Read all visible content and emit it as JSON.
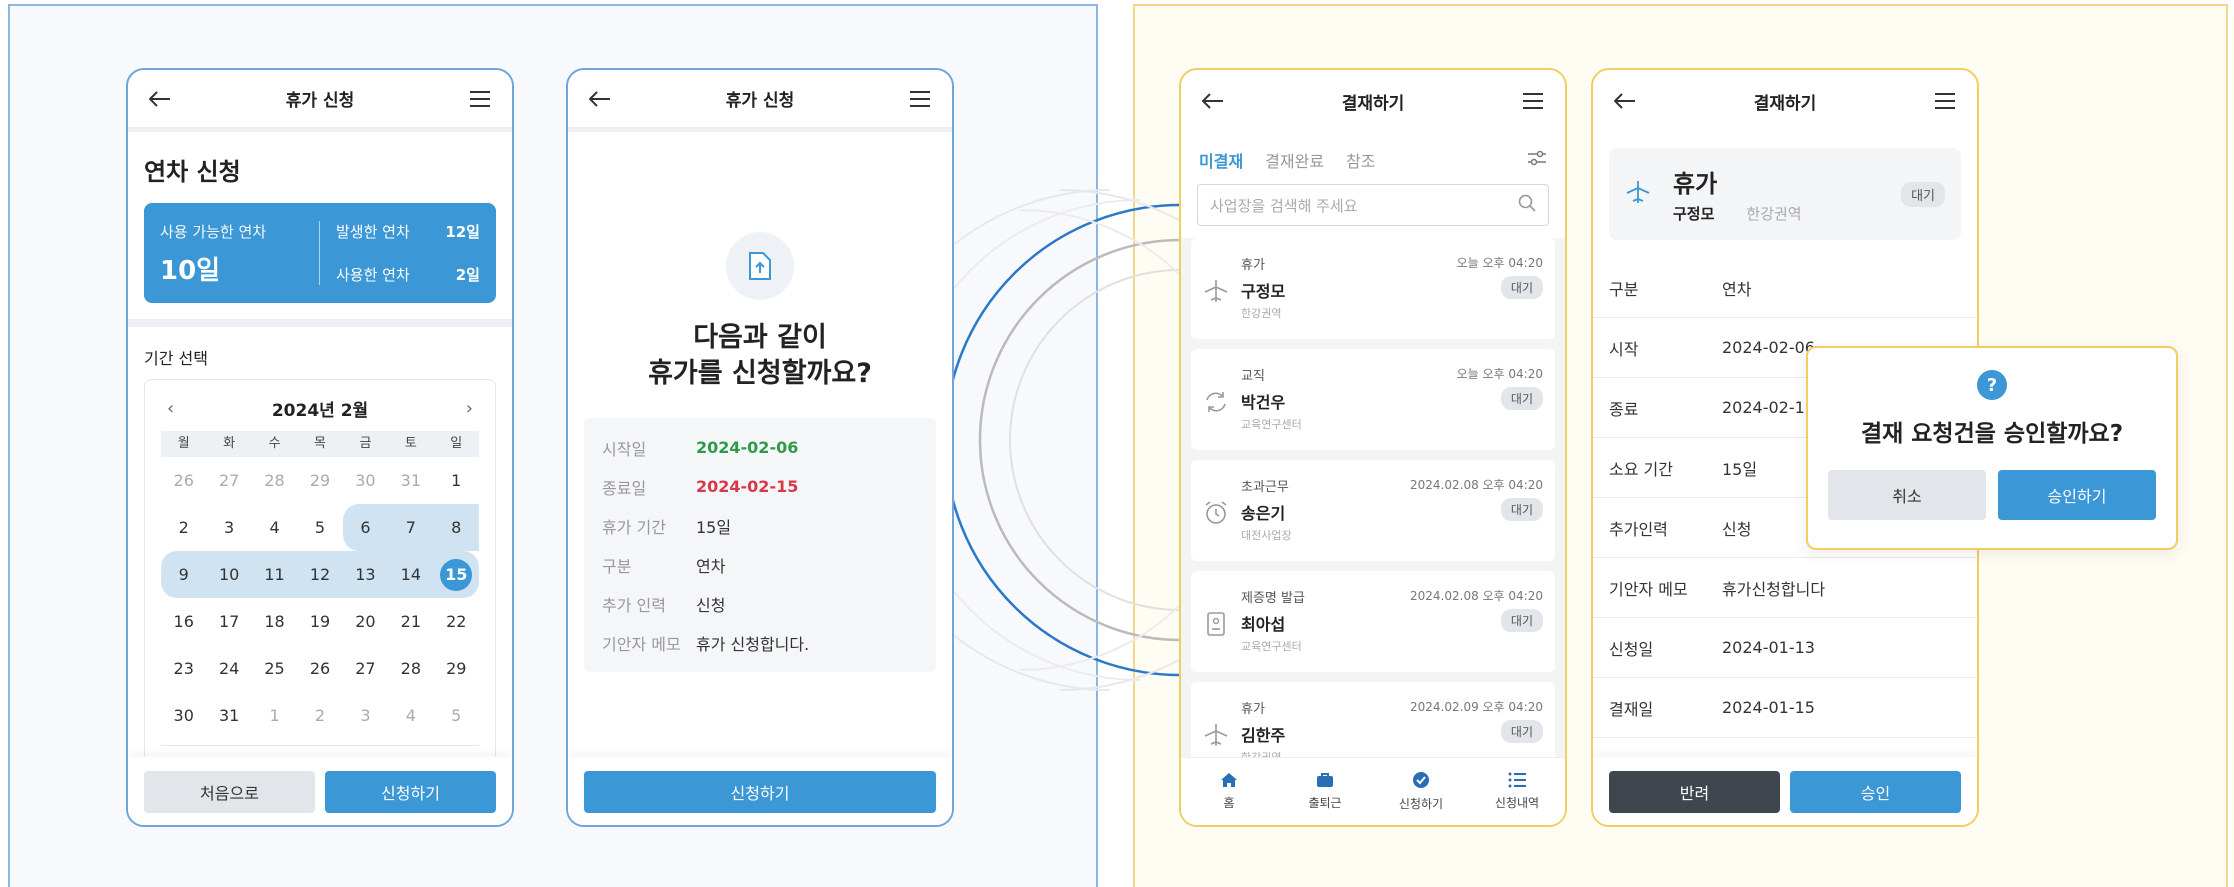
{
  "phone1": {
    "title": "휴가 신청",
    "heading": "연차 신청",
    "available_label": "사용 가능한 연차",
    "available_value": "10일",
    "issued_label": "발생한 연차",
    "issued_value": "12일",
    "used_label": "사용한 연차",
    "used_value": "2일",
    "period_label": "기간 선택",
    "calendar": {
      "month": "2024년 2월",
      "weekdays": [
        "월",
        "화",
        "수",
        "목",
        "금",
        "토",
        "일"
      ],
      "weeks": [
        [
          "26",
          "27",
          "28",
          "29",
          "30",
          "31",
          "1"
        ],
        [
          "2",
          "3",
          "4",
          "5",
          "6",
          "7",
          "8"
        ],
        [
          "9",
          "10",
          "11",
          "12",
          "13",
          "14",
          "15"
        ],
        [
          "16",
          "17",
          "18",
          "19",
          "20",
          "21",
          "22"
        ],
        [
          "23",
          "24",
          "25",
          "26",
          "27",
          "28",
          "29"
        ],
        [
          "30",
          "31",
          "1",
          "2",
          "3",
          "4",
          "5"
        ]
      ]
    },
    "btn_reset": "처음으로",
    "btn_submit": "신청하기"
  },
  "phone2": {
    "title": "휴가 신청",
    "confirm_line1": "다음과 같이",
    "confirm_line2": "휴가를 신청할까요?",
    "rows": [
      {
        "k": "시작일",
        "v": "2024-02-06"
      },
      {
        "k": "종료일",
        "v": "2024-02-15"
      },
      {
        "k": "휴가 기간",
        "v": "15일"
      },
      {
        "k": "구분",
        "v": "연차"
      },
      {
        "k": "추가 인력",
        "v": "신청"
      },
      {
        "k": "기안자 메모",
        "v": "휴가 신청합니다."
      }
    ],
    "btn_submit": "신청하기"
  },
  "phone3": {
    "title": "결재하기",
    "tabs": [
      "미결재",
      "결재완료",
      "참조"
    ],
    "search_placeholder": "사업장을 검색해 주세요",
    "items": [
      {
        "type": "휴가",
        "name": "구정모",
        "org": "한강권역",
        "time": "오늘 오후 04:20",
        "badge": "대기"
      },
      {
        "type": "교직",
        "name": "박건우",
        "org": "교육연구센터",
        "time": "오늘 오후 04:20",
        "badge": "대기"
      },
      {
        "type": "초과근무",
        "name": "송은기",
        "org": "대전사업장",
        "time": "2024.02.08 오후 04:20",
        "badge": "대기"
      },
      {
        "type": "제증명 발급",
        "name": "최아섭",
        "org": "교육연구센터",
        "time": "2024.02.08 오후 04:20",
        "badge": "대기"
      },
      {
        "type": "휴가",
        "name": "김한주",
        "org": "한강권역",
        "time": "2024.02.09 오후 04:20",
        "badge": "대기"
      }
    ],
    "tabbar": [
      "홈",
      "출퇴근",
      "신청하기",
      "신청내역"
    ]
  },
  "phone4": {
    "title": "결재하기",
    "doc_title": "휴가",
    "doc_name": "구정모",
    "doc_org": "한강권역",
    "doc_badge": "대기",
    "rows": [
      {
        "k": "구분",
        "v": "연차"
      },
      {
        "k": "시작",
        "v": "2024-02-06"
      },
      {
        "k": "종료",
        "v": "2024-02-15"
      },
      {
        "k": "소요 기간",
        "v": "15일"
      },
      {
        "k": "추가인력",
        "v": "신청"
      },
      {
        "k": "기안자 메모",
        "v": "휴가신청합니다"
      },
      {
        "k": "신청일",
        "v": "2024-01-13"
      },
      {
        "k": "결재일",
        "v": "2024-01-15"
      }
    ],
    "btn_reject": "반려",
    "btn_approve": "승인"
  },
  "modal": {
    "message": "결재 요청건을 승인할까요?",
    "btn_cancel": "취소",
    "btn_approve": "승인하기"
  },
  "colors": {
    "accent": "#3b97d6",
    "range": "#cfe3f2",
    "start_date": "#2f9a4a",
    "end_date": "#d8384a"
  }
}
